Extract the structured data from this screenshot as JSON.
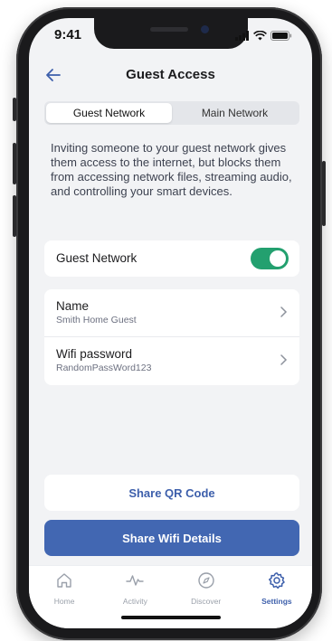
{
  "status_bar": {
    "time": "9:41"
  },
  "header": {
    "title": "Guest Access"
  },
  "segmented": {
    "tabs": [
      {
        "label": "Guest Network"
      },
      {
        "label": "Main Network"
      }
    ],
    "active": 0
  },
  "description": "Inviting someone to your guest network gives them access to the internet, but blocks them from accessing network files, streaming audio, and controlling your smart devices.",
  "guest_toggle": {
    "label": "Guest Network",
    "enabled": true
  },
  "details": [
    {
      "label": "Name",
      "value": "Smith Home Guest"
    },
    {
      "label": "Wifi password",
      "value": "RandomPassWord123"
    }
  ],
  "actions": {
    "qr_label": "Share QR Code",
    "wifi_label": "Share Wifi Details"
  },
  "tabbar": {
    "items": [
      {
        "label": "Home",
        "icon": "home-icon"
      },
      {
        "label": "Activity",
        "icon": "activity-icon"
      },
      {
        "label": "Discover",
        "icon": "compass-icon"
      },
      {
        "label": "Settings",
        "icon": "gear-icon"
      }
    ],
    "active": 3
  },
  "colors": {
    "accent": "#4267b2",
    "toggle_on": "#23a06f",
    "background": "#f2f3f5"
  }
}
